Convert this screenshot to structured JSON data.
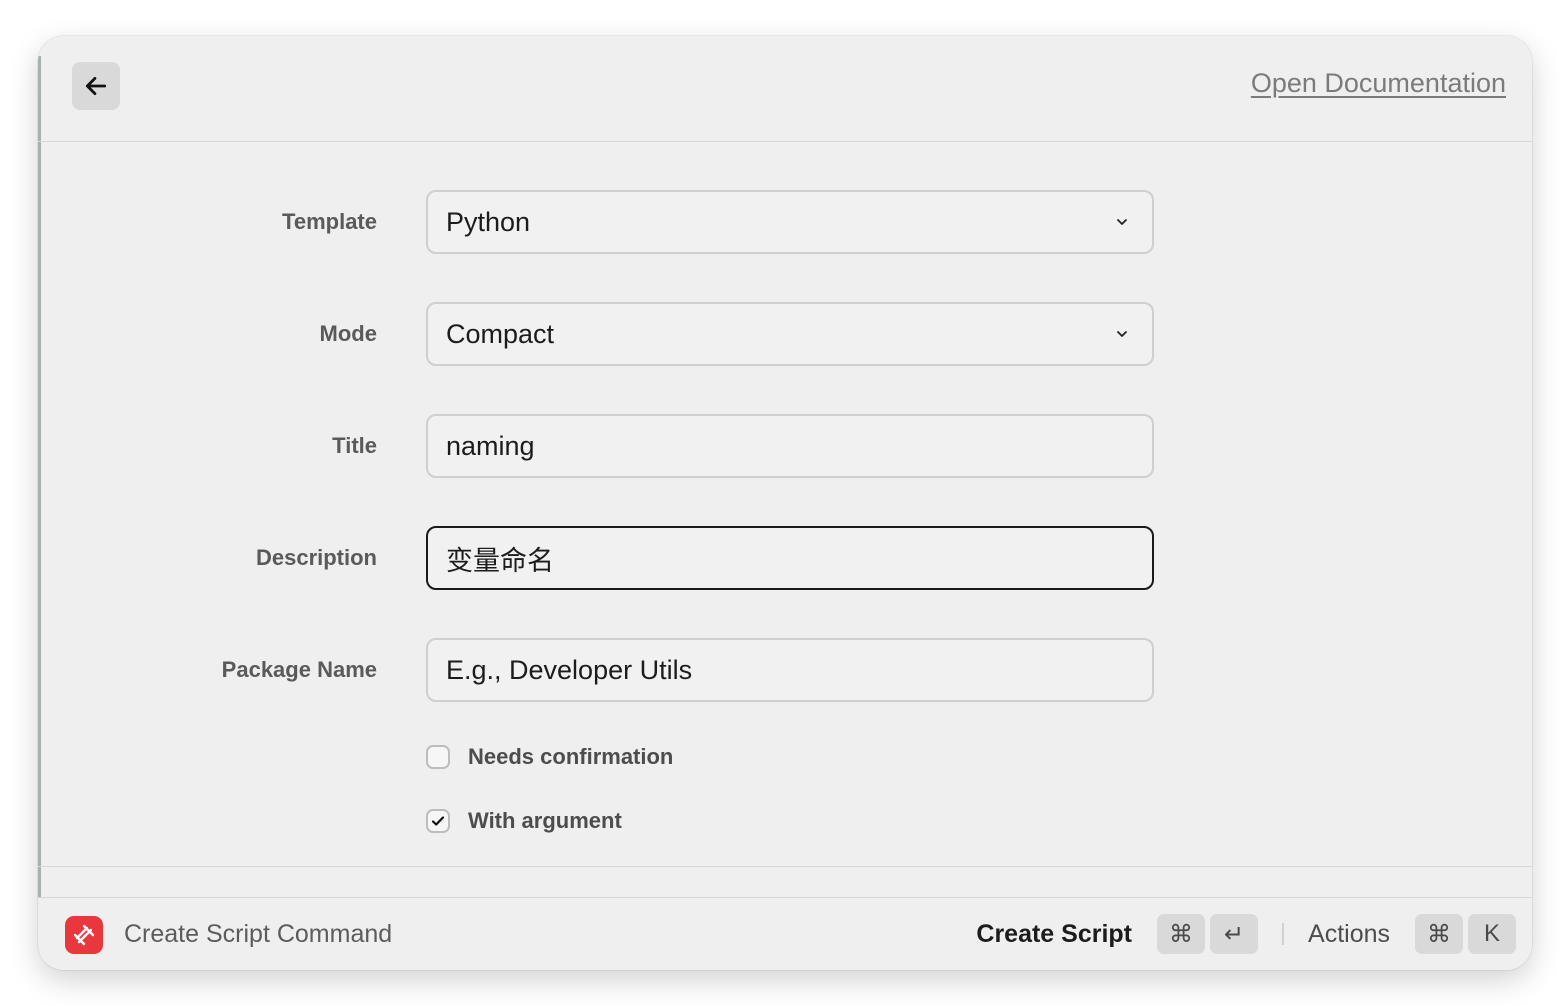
{
  "header": {
    "open_documentation": "Open Documentation"
  },
  "form": {
    "template": {
      "label": "Template",
      "value": "Python"
    },
    "mode": {
      "label": "Mode",
      "value": "Compact"
    },
    "title": {
      "label": "Title",
      "value": "naming"
    },
    "description": {
      "label": "Description",
      "value": "变量命名"
    },
    "package_name": {
      "label": "Package Name",
      "value": "",
      "placeholder": "E.g., Developer Utils"
    },
    "needs_confirmation": {
      "label": "Needs confirmation",
      "checked": false
    },
    "with_argument": {
      "label": "With argument",
      "checked": true
    }
  },
  "footer": {
    "command_title": "Create Script Command",
    "primary_action": "Create Script",
    "primary_shortcut": [
      "⌘",
      "↵"
    ],
    "actions_label": "Actions",
    "actions_shortcut": [
      "⌘",
      "K"
    ]
  },
  "colors": {
    "app_icon": "#e8383d",
    "window_bg": "#efefef"
  }
}
